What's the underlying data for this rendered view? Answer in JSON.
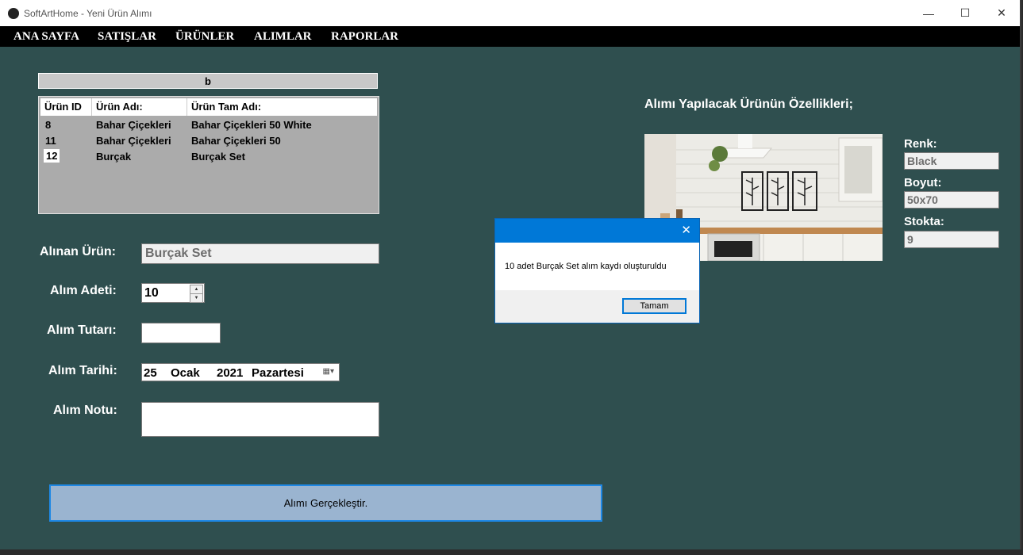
{
  "window": {
    "title": "SoftArtHome - Yeni Ürün Alımı",
    "minimize": "—",
    "maximize": "☐",
    "close": "✕"
  },
  "menu": [
    "ANA SAYFA",
    "SATIŞLAR",
    "ÜRÜNLER",
    "ALIMLAR",
    "RAPORLAR"
  ],
  "grid": {
    "title": "b",
    "headers": [
      "Ürün ID",
      "Ürün Adı:",
      "Ürün Tam Adı:"
    ],
    "rows": [
      [
        "8",
        "Bahar Çiçekleri",
        "Bahar Çiçekleri 50 White"
      ],
      [
        "11",
        "Bahar Çiçekleri",
        "Bahar Çiçekleri 50"
      ],
      [
        "12",
        "Burçak",
        "Burçak Set"
      ]
    ]
  },
  "form": {
    "product_label": "Alınan Ürün:",
    "product_value": "Burçak Set",
    "qty_label": "Alım Adeti:",
    "qty_value": "10",
    "amount_label": "Alım Tutarı:",
    "amount_value": "",
    "date_label": "Alım Tarihi:",
    "date_day": "25",
    "date_month": "Ocak",
    "date_year": "2021",
    "date_weekday": "Pazartesi",
    "note_label": "Alım Notu:",
    "note_value": "",
    "submit": "Alımı Gerçekleştir."
  },
  "props": {
    "title": "Alımı Yapılacak Ürünün Özellikleri;",
    "color_label": "Renk:",
    "color_value": "Black",
    "size_label": "Boyut:",
    "size_value": "50x70",
    "stock_label": "Stokta:",
    "stock_value": "9"
  },
  "dialog": {
    "message": "10 adet Burçak Set alım kaydı oluşturuldu",
    "ok": "Tamam",
    "close": "✕"
  },
  "colors": {
    "background": "#2f4f4f",
    "menubar": "#000000",
    "dialog_bar": "#0078d7",
    "submit": "#9ab4d0"
  }
}
